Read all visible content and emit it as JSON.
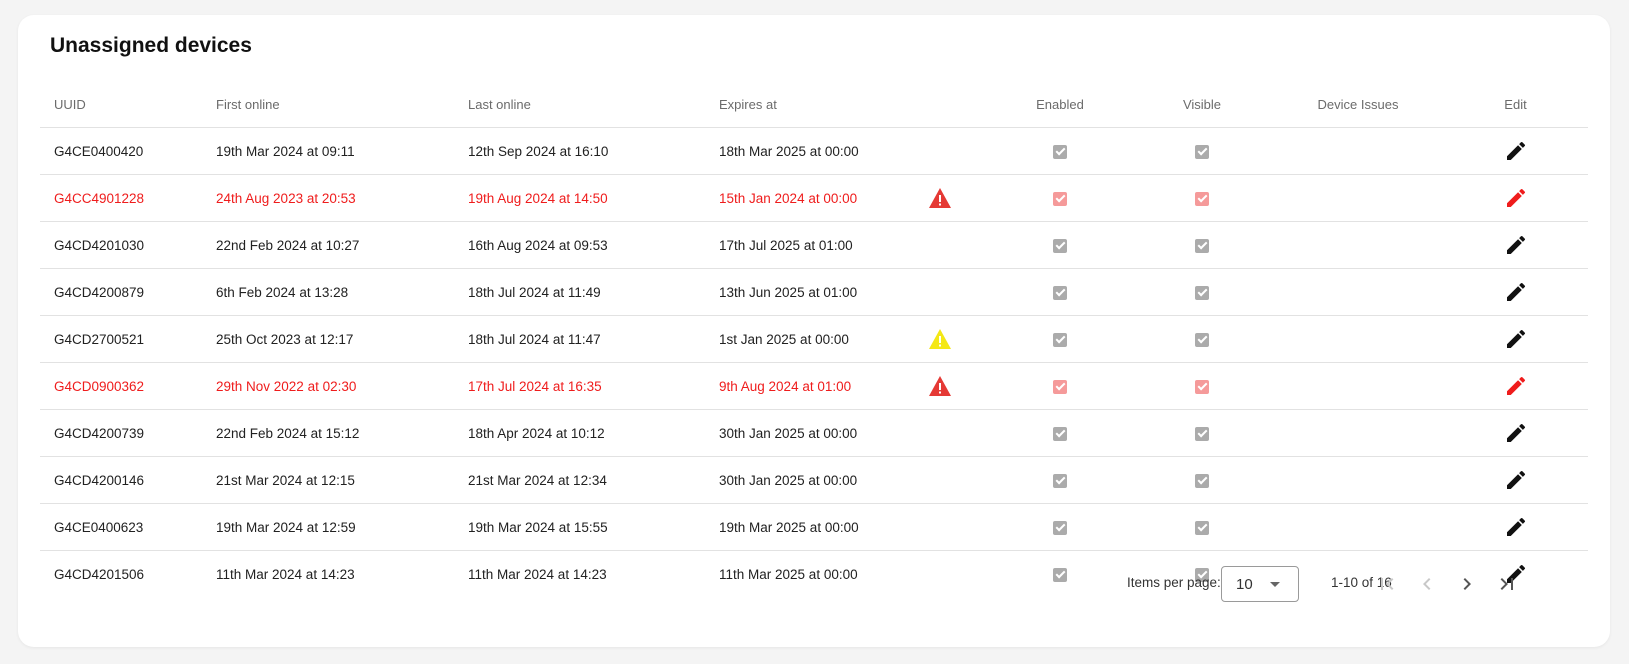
{
  "title": "Unassigned devices",
  "columns": {
    "uuid": "UUID",
    "first_online": "First online",
    "last_online": "Last online",
    "expires_at": "Expires at",
    "enabled": "Enabled",
    "visible": "Visible",
    "device_issues": "Device Issues",
    "edit": "Edit"
  },
  "rows": [
    {
      "uuid": "G4CE0400420",
      "first_online": "19th Mar 2024 at 09:11",
      "last_online": "12th Sep 2024 at 16:10",
      "expires_at": "18th Mar 2025 at 00:00",
      "warning": "none",
      "status": "normal",
      "enabled": true,
      "visible": true
    },
    {
      "uuid": "G4CC4901228",
      "first_online": "24th Aug 2023 at 20:53",
      "last_online": "19th Aug 2024 at 14:50",
      "expires_at": "15th Jan 2024 at 00:00",
      "warning": "red",
      "status": "error",
      "enabled": true,
      "visible": true
    },
    {
      "uuid": "G4CD4201030",
      "first_online": "22nd Feb 2024 at 10:27",
      "last_online": "16th Aug 2024 at 09:53",
      "expires_at": "17th Jul 2025 at 01:00",
      "warning": "none",
      "status": "normal",
      "enabled": true,
      "visible": true
    },
    {
      "uuid": "G4CD4200879",
      "first_online": "6th Feb 2024 at 13:28",
      "last_online": "18th Jul 2024 at 11:49",
      "expires_at": "13th Jun 2025 at 01:00",
      "warning": "none",
      "status": "normal",
      "enabled": true,
      "visible": true
    },
    {
      "uuid": "G4CD2700521",
      "first_online": "25th Oct 2023 at 12:17",
      "last_online": "18th Jul 2024 at 11:47",
      "expires_at": "1st Jan 2025 at 00:00",
      "warning": "yellow",
      "status": "normal",
      "enabled": true,
      "visible": true
    },
    {
      "uuid": "G4CD0900362",
      "first_online": "29th Nov 2022 at 02:30",
      "last_online": "17th Jul 2024 at 16:35",
      "expires_at": "9th Aug 2024 at 01:00",
      "warning": "red",
      "status": "error",
      "enabled": true,
      "visible": true
    },
    {
      "uuid": "G4CD4200739",
      "first_online": "22nd Feb 2024 at 15:12",
      "last_online": "18th Apr 2024 at 10:12",
      "expires_at": "30th Jan 2025 at 00:00",
      "warning": "none",
      "status": "normal",
      "enabled": true,
      "visible": true
    },
    {
      "uuid": "G4CD4200146",
      "first_online": "21st Mar 2024 at 12:15",
      "last_online": "21st Mar 2024 at 12:34",
      "expires_at": "30th Jan 2025 at 00:00",
      "warning": "none",
      "status": "normal",
      "enabled": true,
      "visible": true
    },
    {
      "uuid": "G4CE0400623",
      "first_online": "19th Mar 2024 at 12:59",
      "last_online": "19th Mar 2024 at 15:55",
      "expires_at": "19th Mar 2025 at 00:00",
      "warning": "none",
      "status": "normal",
      "enabled": true,
      "visible": true
    },
    {
      "uuid": "G4CD4201506",
      "first_online": "11th Mar 2024 at 14:23",
      "last_online": "11th Mar 2024 at 14:23",
      "expires_at": "11th Mar 2025 at 00:00",
      "warning": "none",
      "status": "normal",
      "enabled": true,
      "visible": true
    }
  ],
  "pagination": {
    "items_per_page_label": "Items per page:",
    "items_per_page_value": "10",
    "range": "1-10 of 16",
    "first_icon": "first-page-icon",
    "prev_icon": "chevron-left-icon",
    "next_icon": "chevron-right-icon",
    "last_icon": "last-page-icon"
  },
  "colors": {
    "error_text": "#ef1c1c",
    "warning_red": "#e53935",
    "warning_yellow": "#f4e816",
    "checkbox_grey": "#ababab",
    "checkbox_error": "#f59a9a",
    "edit_icon": "#111111",
    "edit_icon_error": "#ef1c1c"
  },
  "icons": {
    "edit": "pencil-icon",
    "warning": "warning-triangle-icon",
    "checkbox": "checkbox-checked-icon"
  }
}
